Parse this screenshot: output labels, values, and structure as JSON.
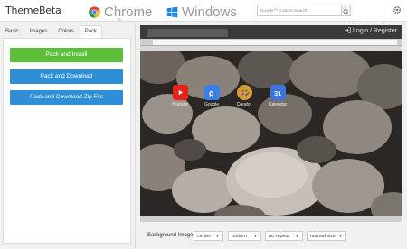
{
  "header": {
    "logo": "ThemeBeta",
    "nav": [
      {
        "label": "Chrome",
        "icon": "chrome-icon",
        "active": true
      },
      {
        "label": "Windows",
        "icon": "windows-icon",
        "active": false
      }
    ],
    "search_placeholder": "Google™ Custom Search"
  },
  "sidebar": {
    "tabs": [
      "Basic",
      "Images",
      "Colors",
      "Pack"
    ],
    "active_tab": "Pack",
    "buttons": [
      {
        "label": "Pack and Install",
        "color": "#5bbf3a"
      },
      {
        "label": "Pack and Download",
        "color": "#2f8fd6"
      },
      {
        "label": "Pack and Download Zip File",
        "color": "#2f8fd6"
      }
    ]
  },
  "preview": {
    "login_text": "Login / Register",
    "apps": [
      {
        "label": "Youtube",
        "icon": "youtube-icon",
        "color": "#e62117"
      },
      {
        "label": "Google",
        "icon": "google-search-icon",
        "color": "#3a7ee8"
      },
      {
        "label": "Creator",
        "icon": "palette-icon",
        "color": "#d69a3a"
      },
      {
        "label": "Calendar",
        "icon": "calendar-icon",
        "color": "#3b74e0"
      }
    ]
  },
  "background_controls": {
    "label": "Background Image:",
    "position_h": "center",
    "position_v": "bottom",
    "repeat": "no repeat",
    "size": "normal size"
  }
}
